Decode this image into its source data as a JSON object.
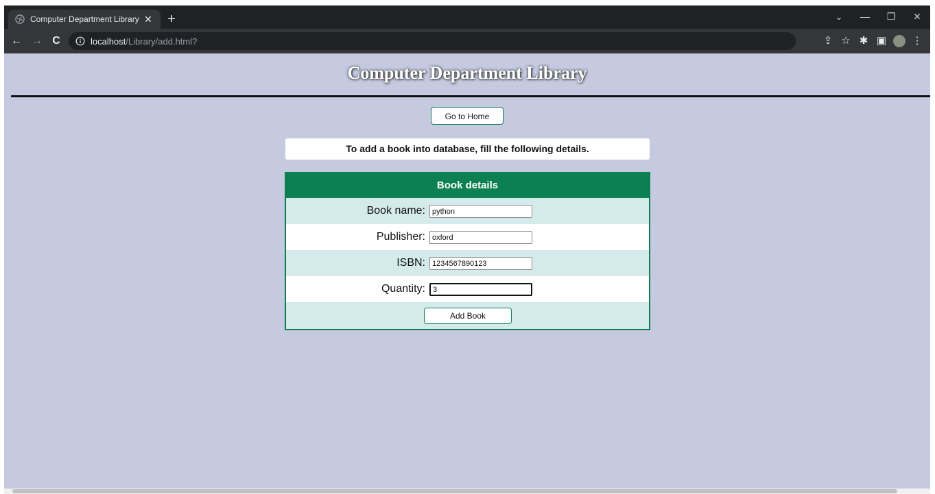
{
  "browser": {
    "tab_title": "Computer Department Library",
    "tab_close": "✕",
    "new_tab": "+",
    "url_host": "localhost",
    "url_path": "/Library/add.html?",
    "window_controls": {
      "dropdown": "⌄",
      "minimize": "—",
      "restore": "❐",
      "close": "✕"
    },
    "nav": {
      "back": "←",
      "forward": "→",
      "reload": "C"
    },
    "toolbar_icons": {
      "share": "⇪",
      "bookmark": "☆",
      "extensions": "✱",
      "sidepanel": "▣",
      "menu": "⋮"
    }
  },
  "page": {
    "title": "Computer Department Library",
    "home_button": "Go to Home",
    "notice": "To add a book into database, fill the following details.",
    "form": {
      "heading": "Book details",
      "fields": [
        {
          "label": "Book name:",
          "value": "python"
        },
        {
          "label": "Publisher:",
          "value": "oxford"
        },
        {
          "label": "ISBN:",
          "value": "1234567890123"
        },
        {
          "label": "Quantity:",
          "value": "3"
        }
      ],
      "submit": "Add Book"
    }
  },
  "colors": {
    "page_bg": "#c5cae1",
    "accent_green": "#0c8050",
    "row_tint": "#d5ebeb"
  }
}
